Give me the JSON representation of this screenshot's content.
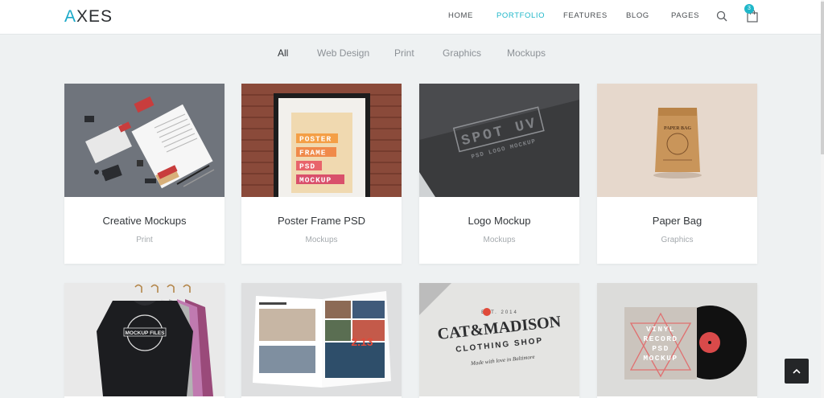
{
  "brand": {
    "first_letter": "A",
    "rest": "XES"
  },
  "nav": {
    "items": [
      "HOME",
      "PORTFOLIO",
      "FEATURES",
      "BLOG",
      "PAGES"
    ],
    "active": "PORTFOLIO",
    "cart_count": "3",
    "search_icon": "search-icon",
    "cart_icon": "shopping-bag-icon"
  },
  "filters": {
    "items": [
      "All",
      "Web Design",
      "Print",
      "Graphics",
      "Mockups"
    ],
    "active": "All"
  },
  "portfolio": [
    {
      "title": "Creative Mockups",
      "category": "Print"
    },
    {
      "title": "Poster Frame PSD",
      "category": "Mockups",
      "poster_lines": [
        "POSTER",
        "FRAME",
        "PSD",
        "MOCKUP"
      ]
    },
    {
      "title": "Logo Mockup",
      "category": "Mockups",
      "logo_text": "SPOT UV",
      "logo_sub": "PSD  LOGO MOCKUP"
    },
    {
      "title": "Paper Bag",
      "category": "Graphics",
      "bag_label": "PAPER BAG"
    },
    {
      "mockup_label": "MOCKUP FILES"
    },
    {
      "page_number": "2.13"
    },
    {
      "brand_line1": "CAT&MADISON",
      "brand_line2": "CLOTHING SHOP",
      "est": "EST. 2014",
      "script": "Made with love in Baltimore"
    },
    {
      "vinyl_lines": [
        "VINYL",
        "RECORD",
        "PSD",
        "MOCKUP"
      ]
    }
  ],
  "colors": {
    "accent": "#1fb7c9",
    "background": "#eef1f2"
  },
  "scroll_top_icon": "chevron-up-icon"
}
